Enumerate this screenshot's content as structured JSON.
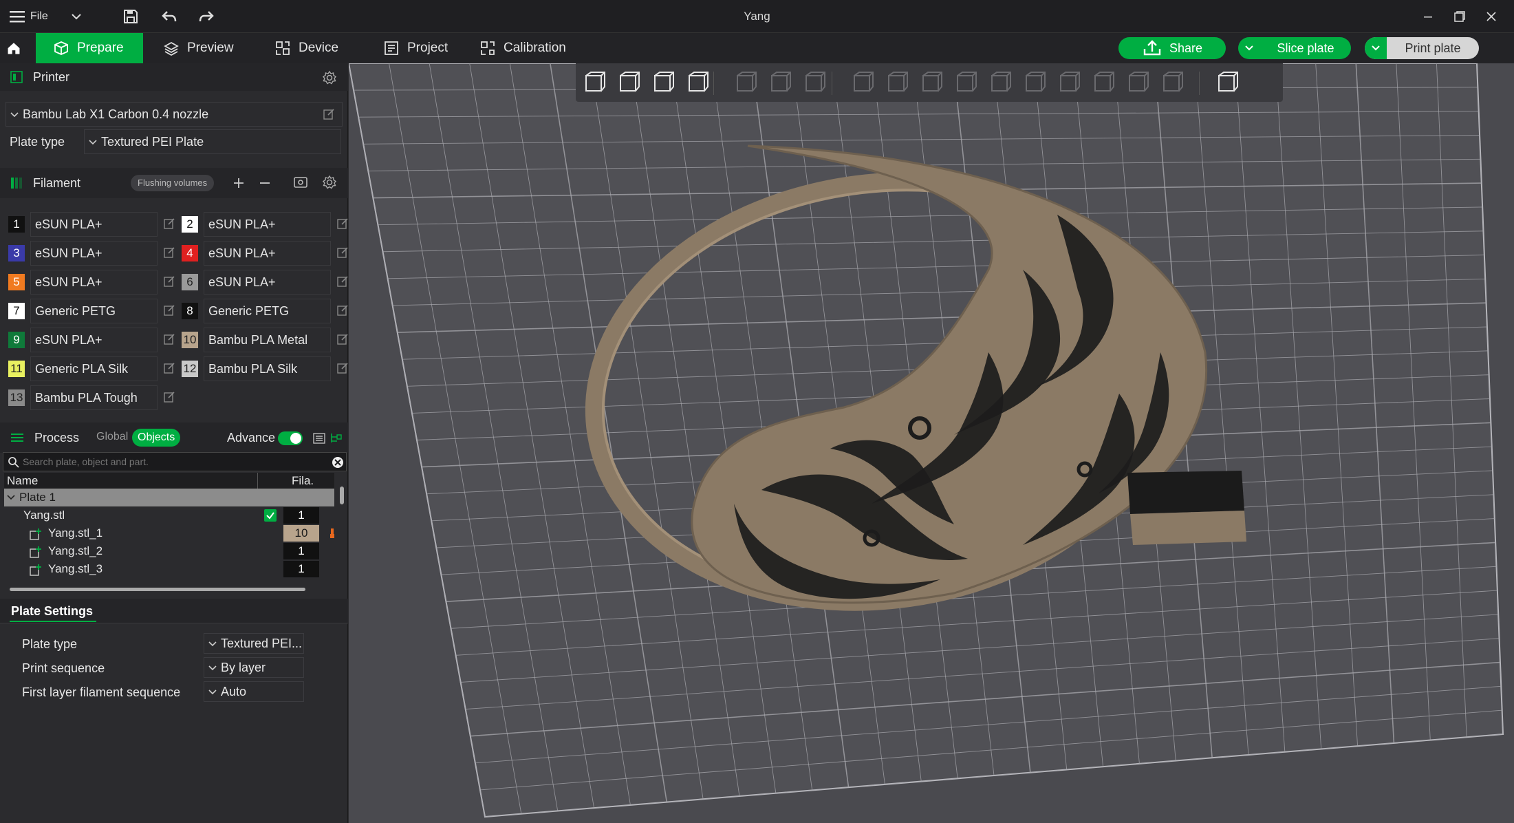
{
  "window": {
    "title": "Yang",
    "file_menu_label": "File"
  },
  "nav": {
    "tabs": [
      {
        "label": "Prepare",
        "active": true
      },
      {
        "label": "Preview"
      },
      {
        "label": "Device"
      },
      {
        "label": "Project"
      },
      {
        "label": "Calibration"
      }
    ],
    "share_label": "Share",
    "slice_label": "Slice plate",
    "print_label": "Print plate"
  },
  "printer": {
    "section_label": "Printer",
    "selected": "Bambu Lab X1 Carbon 0.4 nozzle",
    "plate_type_label": "Plate type",
    "plate_type_value": "Textured PEI Plate"
  },
  "filament": {
    "section_label": "Filament",
    "flushing_label": "Flushing volumes",
    "items": [
      {
        "num": "1",
        "name": "eSUN PLA+",
        "color": "#111111",
        "num_color": "#ffffff"
      },
      {
        "num": "2",
        "name": "eSUN PLA+",
        "color": "#ffffff",
        "num_color": "#111111"
      },
      {
        "num": "3",
        "name": "eSUN PLA+",
        "color": "#3a3aa8",
        "num_color": "#ffffff"
      },
      {
        "num": "4",
        "name": "eSUN PLA+",
        "color": "#e02020",
        "num_color": "#ffffff"
      },
      {
        "num": "5",
        "name": "eSUN PLA+",
        "color": "#f07a20",
        "num_color": "#ffffff"
      },
      {
        "num": "6",
        "name": "eSUN PLA+",
        "color": "#9a9a9a",
        "num_color": "#222222"
      },
      {
        "num": "7",
        "name": "Generic PETG",
        "color": "#ffffff",
        "num_color": "#111111"
      },
      {
        "num": "8",
        "name": "Generic PETG",
        "color": "#111111",
        "num_color": "#ffffff"
      },
      {
        "num": "9",
        "name": "eSUN PLA+",
        "color": "#0f7a3a",
        "num_color": "#ffffff"
      },
      {
        "num": "10",
        "name": "Bambu PLA Metal",
        "color": "#b8a48c",
        "num_color": "#222222"
      },
      {
        "num": "11",
        "name": "Generic PLA Silk",
        "color": "#e8f060",
        "num_color": "#222222"
      },
      {
        "num": "12",
        "name": "Bambu PLA Silk",
        "color": "#c9c9c9",
        "num_color": "#222222"
      },
      {
        "num": "13",
        "name": "Bambu PLA Tough",
        "color": "#8a8a8a",
        "num_color": "#222222"
      }
    ]
  },
  "process": {
    "section_label": "Process",
    "global_label": "Global",
    "objects_label": "Objects",
    "advance_label": "Advance",
    "advance_on": true,
    "search_placeholder": "Search plate, object and part."
  },
  "object_tree": {
    "col_name": "Name",
    "col_fila": "Fila.",
    "rows": [
      {
        "name": "Plate 1",
        "fila": ""
      },
      {
        "name": "Yang.stl",
        "fila": "1"
      },
      {
        "name": "Yang.stl_1",
        "fila": "10"
      },
      {
        "name": "Yang.stl_2",
        "fila": "1"
      },
      {
        "name": "Yang.stl_3",
        "fila": "1"
      }
    ]
  },
  "plate_settings": {
    "title": "Plate Settings",
    "rows": [
      {
        "label": "Plate type",
        "value": "Textured PEI..."
      },
      {
        "label": "Print sequence",
        "value": "By layer"
      },
      {
        "label": "First layer filament sequence",
        "value": "Auto"
      }
    ]
  },
  "colors": {
    "accent": "#00ae42",
    "model": "#8b7a65",
    "pattern": "#1c1c1c"
  }
}
